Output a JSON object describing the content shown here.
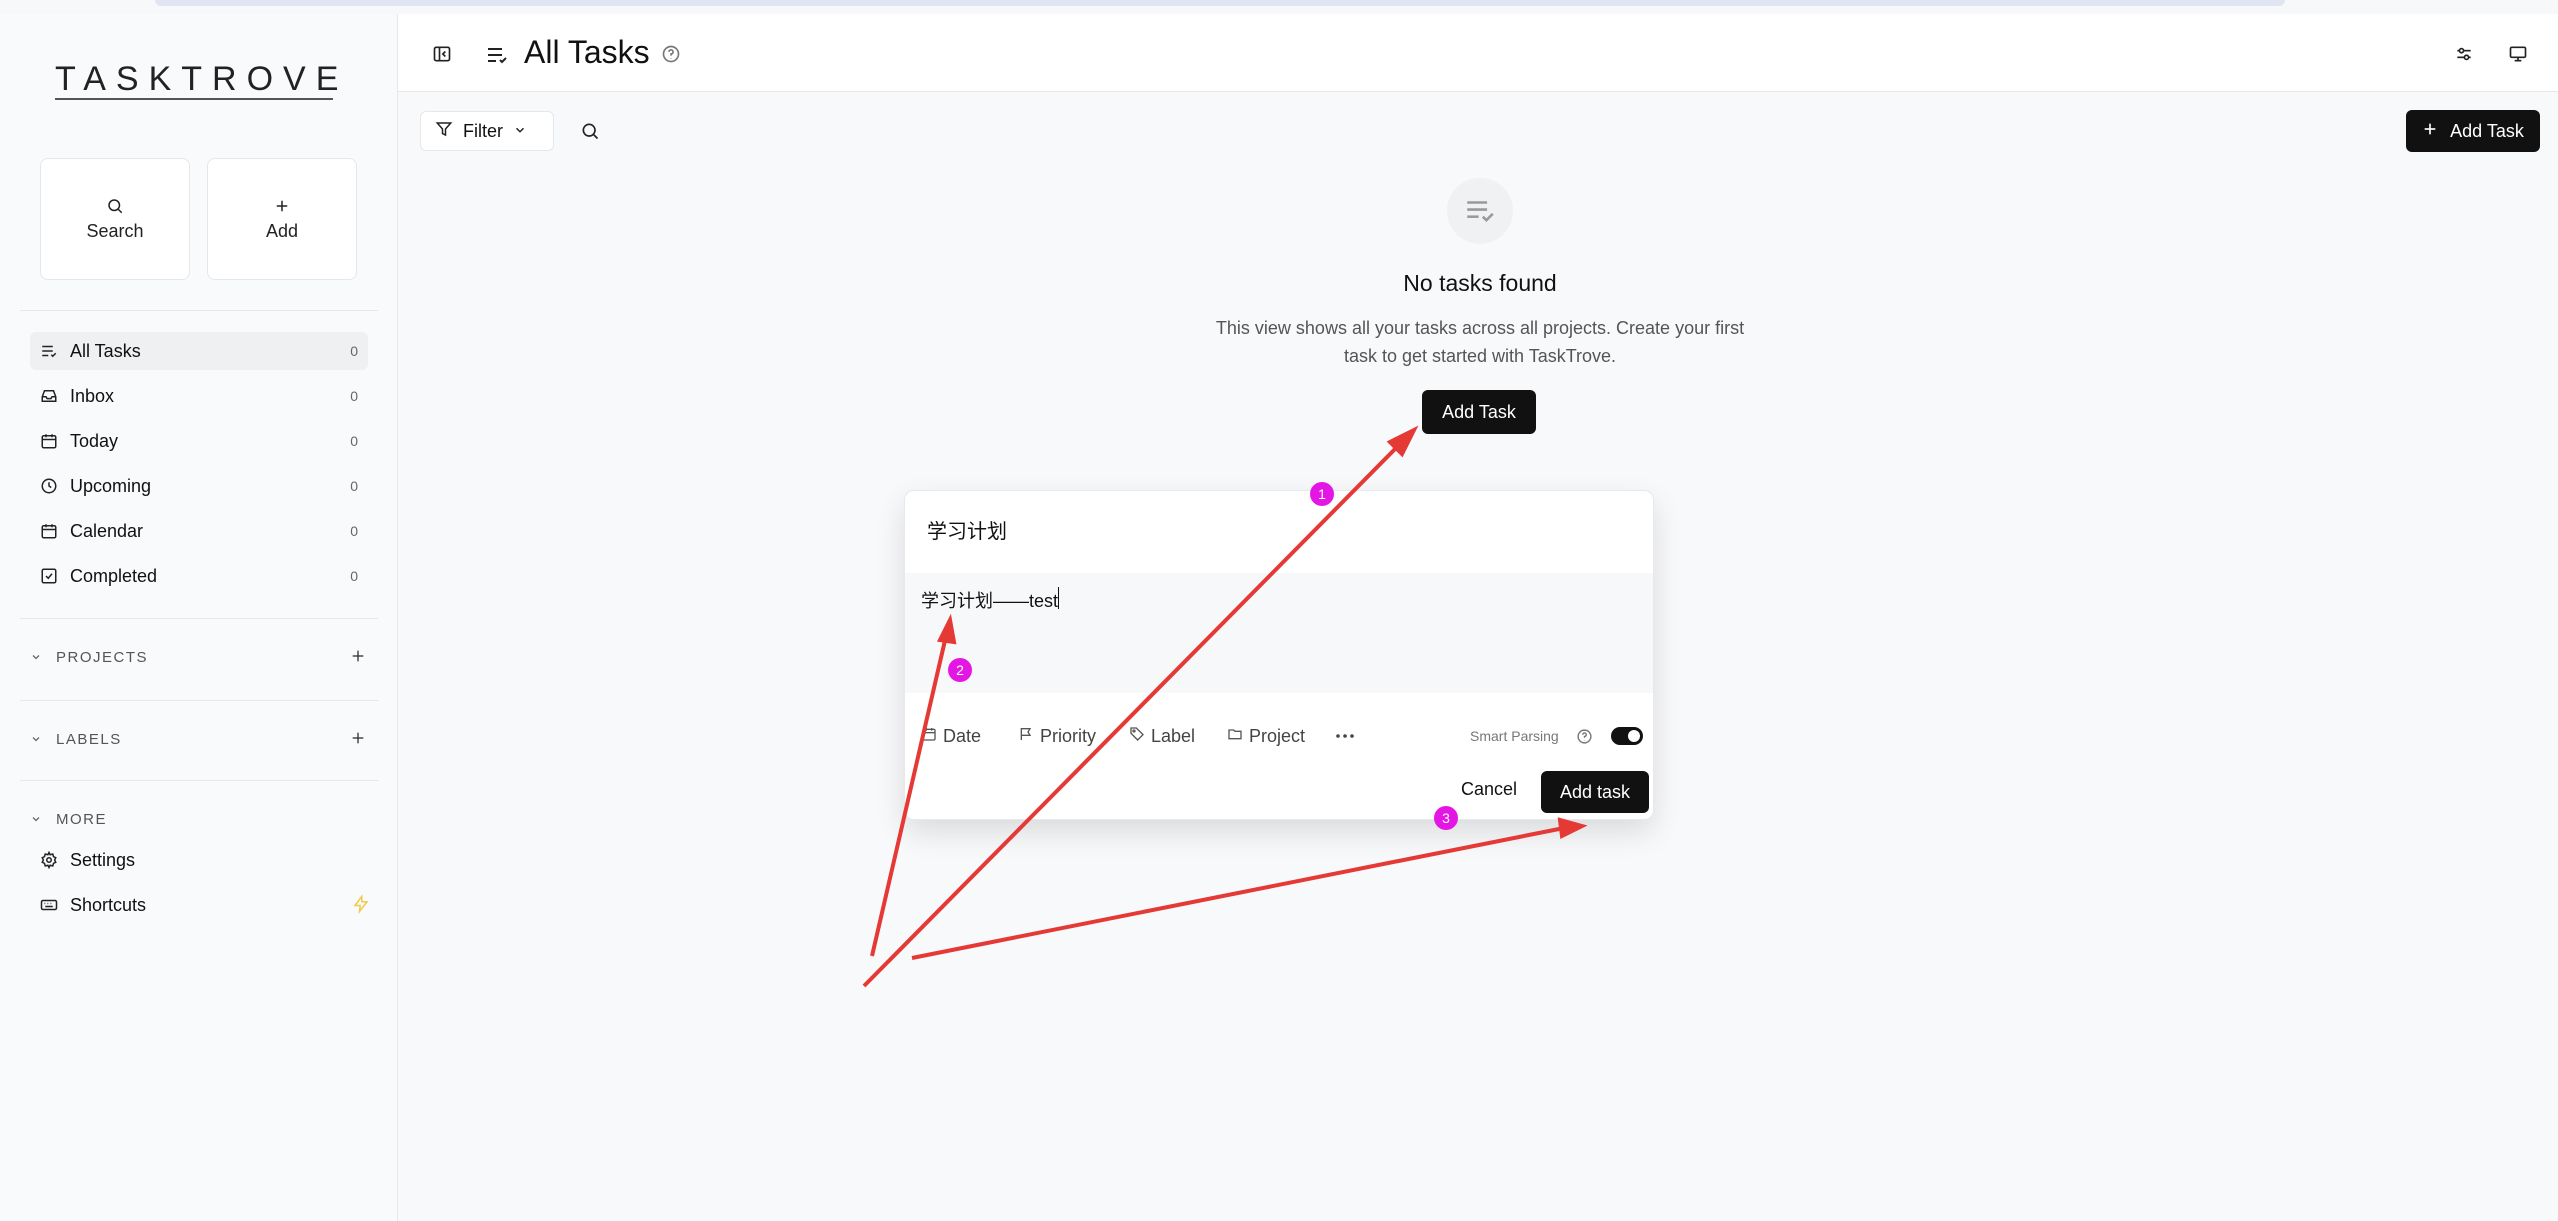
{
  "app": {
    "logo": "TASKTROVE"
  },
  "quick": {
    "search_label": "Search",
    "add_label": "Add"
  },
  "nav": [
    {
      "label": "All Tasks",
      "count": "0",
      "icon": "list-icon"
    },
    {
      "label": "Inbox",
      "count": "0",
      "icon": "inbox-icon"
    },
    {
      "label": "Today",
      "count": "0",
      "icon": "calendar-icon"
    },
    {
      "label": "Upcoming",
      "count": "0",
      "icon": "clock-icon"
    },
    {
      "label": "Calendar",
      "count": "0",
      "icon": "calendar-icon"
    },
    {
      "label": "Completed",
      "count": "0",
      "icon": "check-square-icon"
    }
  ],
  "sections": {
    "projects": "PROJECTS",
    "labels": "LABELS",
    "more": "MORE"
  },
  "more_items": [
    {
      "label": "Settings",
      "icon": "gear-icon"
    },
    {
      "label": "Shortcuts",
      "icon": "keyboard-icon"
    }
  ],
  "header": {
    "title": "All Tasks"
  },
  "toolbar": {
    "filter_label": "Filter",
    "add_task_label": "Add Task"
  },
  "empty": {
    "title": "No tasks found",
    "desc_line1": "This view shows all your tasks across all projects. Create your first",
    "desc_line2": "task to get started with TaskTrove.",
    "button": "Add Task"
  },
  "dialog": {
    "title_value": "学习计划",
    "desc_value": "学习计划——test",
    "options": [
      "Date",
      "Priority",
      "Label",
      "Project"
    ],
    "smart_parsing": "Smart Parsing",
    "cancel": "Cancel",
    "submit": "Add task"
  },
  "annotations": {
    "badges": [
      "1",
      "2",
      "3"
    ],
    "color": "#e53935",
    "badge_color": "#e416e4"
  }
}
